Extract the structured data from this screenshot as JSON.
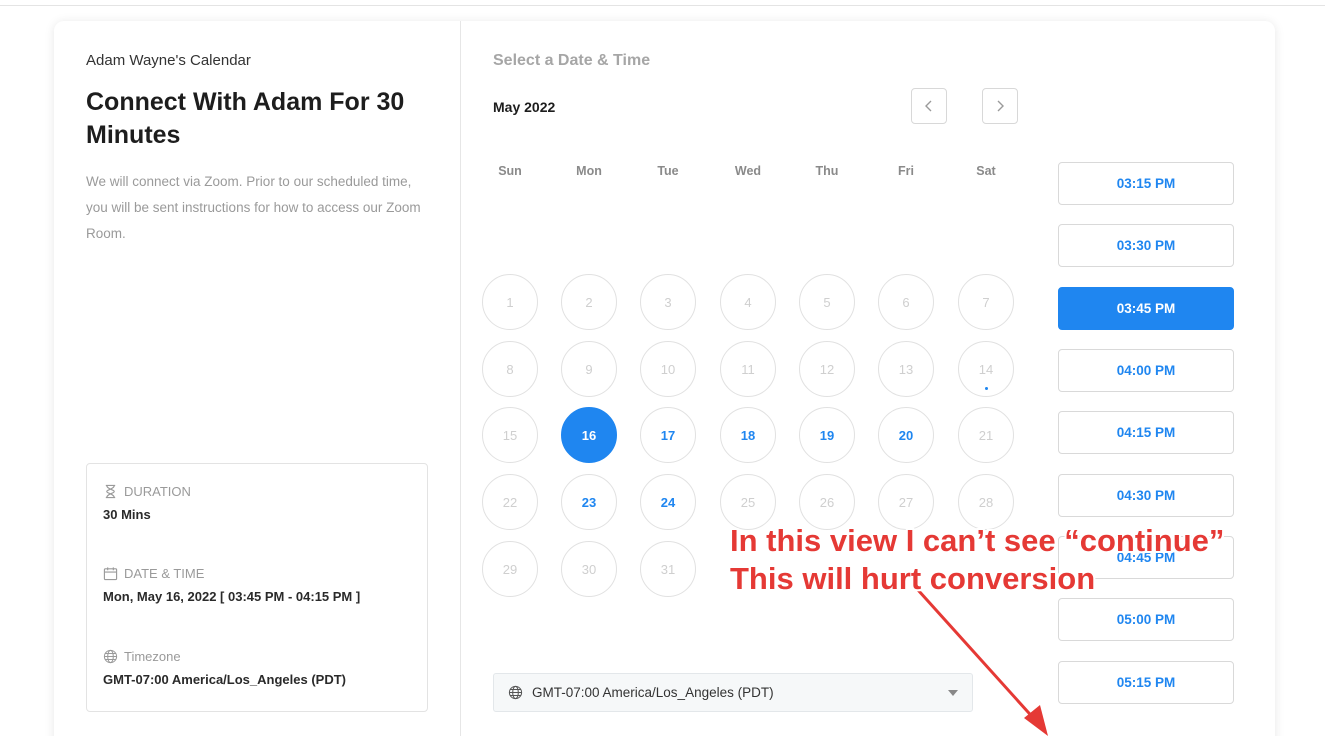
{
  "event": {
    "owner": "Adam Wayne's Calendar",
    "title": "Connect With Adam For 30 Minutes",
    "description": "We will connect via Zoom. Prior to our scheduled time, you will be sent instructions for how to access our Zoom Room."
  },
  "details": {
    "duration_label": "DURATION",
    "duration_value": "30 Mins",
    "datetime_label": "DATE & TIME",
    "datetime_value": "Mon, May 16, 2022 [ 03:45 PM - 04:15 PM ]",
    "timezone_label": "Timezone",
    "timezone_value": "GMT-07:00 America/Los_Angeles (PDT)"
  },
  "calendar": {
    "heading": "Select a Date & Time",
    "month": "May 2022",
    "weekdays": [
      "Sun",
      "Mon",
      "Tue",
      "Wed",
      "Thu",
      "Fri",
      "Sat"
    ],
    "days": [
      "1",
      "2",
      "3",
      "4",
      "5",
      "6",
      "7",
      "8",
      "9",
      "10",
      "11",
      "12",
      "13",
      "14",
      "15",
      "16",
      "17",
      "18",
      "19",
      "20",
      "21",
      "22",
      "23",
      "24",
      "25",
      "26",
      "27",
      "28",
      "29",
      "30",
      "31"
    ],
    "available_days": [
      "16",
      "17",
      "18",
      "19",
      "20",
      "23",
      "24"
    ],
    "selected_day": "16",
    "today_day": "14"
  },
  "time_slots": [
    "03:15 PM",
    "03:30 PM",
    "03:45 PM",
    "04:00 PM",
    "04:15 PM",
    "04:30 PM",
    "04:45 PM",
    "05:00 PM",
    "05:15 PM"
  ],
  "selected_slot": "03:45 PM",
  "timezone_select": "GMT-07:00 America/Los_Angeles (PDT)",
  "annotation": {
    "line1": "In this view I can’t see “continue”",
    "line2": "This will hurt conversion",
    "color": "#e53935"
  },
  "colors": {
    "accent": "#1f86f0"
  },
  "icons": {
    "duration": "hourglass-icon",
    "datetime": "calendar-icon",
    "timezone": "globe-icon",
    "prev": "chevron-left-icon",
    "next": "chevron-right-icon",
    "dropdown": "caret-down-icon"
  }
}
